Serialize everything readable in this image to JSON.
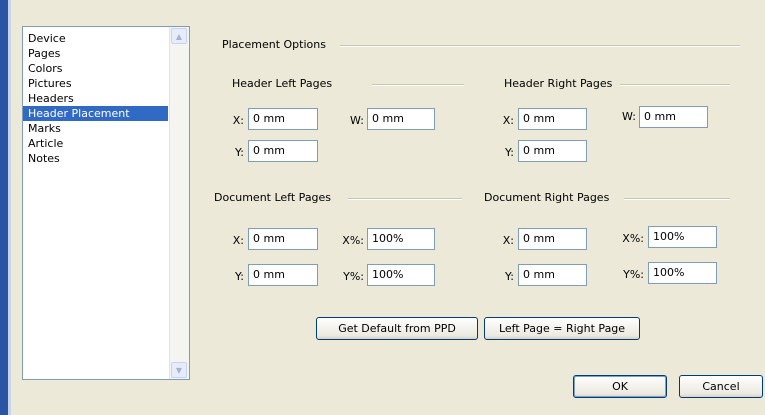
{
  "list": {
    "items": [
      "Device",
      "Pages",
      "Colors",
      "Pictures",
      "Headers",
      "Header Placement",
      "Marks",
      "Article",
      "Notes"
    ],
    "selected_index": 5
  },
  "placement": {
    "title": "Placement Options",
    "header_left": {
      "title": "Header Left Pages",
      "x_label": "X:",
      "x_value": "0 mm",
      "w_label": "W:",
      "w_value": "0 mm",
      "y_label": "Y:",
      "y_value": "0 mm"
    },
    "header_right": {
      "title": "Header Right Pages",
      "x_label": "X:",
      "x_value": "0 mm",
      "w_label": "W:",
      "w_value": "0 mm",
      "y_label": "Y:",
      "y_value": "0 mm"
    },
    "doc_left": {
      "title": "Document Left Pages",
      "x_label": "X:",
      "x_value": "0 mm",
      "xp_label": "X%:",
      "xp_value": "100%",
      "y_label": "Y:",
      "y_value": "0 mm",
      "yp_label": "Y%:",
      "yp_value": "100%"
    },
    "doc_right": {
      "title": "Document Right Pages",
      "x_label": "X:",
      "x_value": "0 mm",
      "xp_label": "X%:",
      "xp_value": "100%",
      "y_label": "Y:",
      "y_value": "0 mm",
      "yp_label": "Y%:",
      "yp_value": "100%"
    }
  },
  "buttons": {
    "get_default": "Get Default from PPD",
    "left_equals_right": "Left Page = Right Page",
    "ok": "OK",
    "cancel": "Cancel"
  },
  "colors": {
    "background": "#ece9d8",
    "selection": "#316ac5",
    "field_border": "#7f9db9",
    "button_border": "#003c74"
  }
}
